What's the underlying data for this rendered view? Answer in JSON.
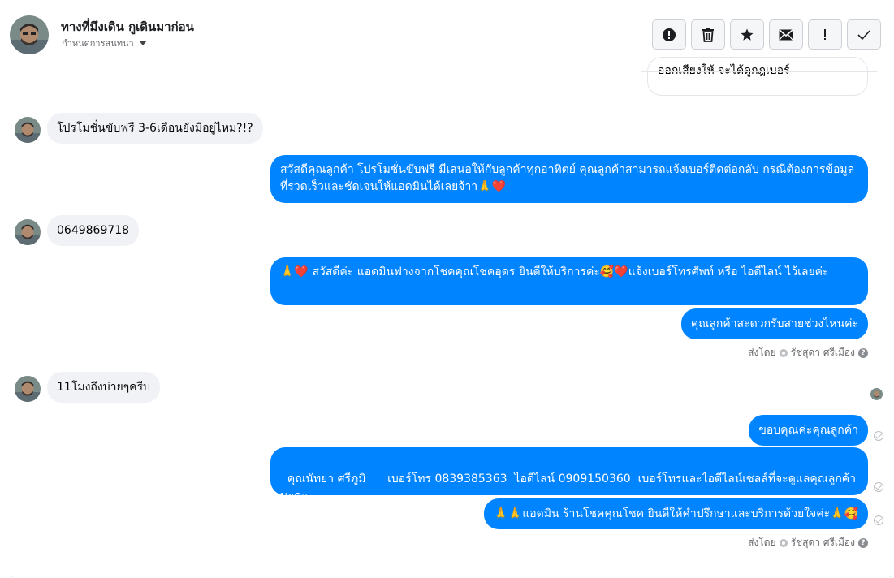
{
  "header": {
    "name": "ทางที่มึงเดิน กูเดินมาก่อน",
    "subtitle": "กำหนดการสนทนา",
    "actions": [
      {
        "name": "report-icon",
        "label": "!"
      },
      {
        "name": "trash-icon",
        "label": "delete"
      },
      {
        "name": "star-icon",
        "label": "star"
      },
      {
        "name": "mail-icon",
        "label": "mail"
      },
      {
        "name": "exclamation-icon",
        "label": "!"
      },
      {
        "name": "check-icon",
        "label": "done"
      }
    ]
  },
  "messages": {
    "top_cut": "ออกเสียงให้ จะได้ดูกฎเบอร์",
    "m1": "โปรโมชั่นขับฟรี 3-6เดือนยังมีอยู่ไหม?!?",
    "m2": "สวัสดีคุณลูกค้า โปรโมชั่นขับฟรี มีเสนอให้กับลูกค้าทุกอาทิตย์ คุณลูกค้าสามารถแจ้งเบอร์ติดต่อกลับ กรณีต้องการข้อมูลที่รวดเร็วและชัดเจนให้แอดมินได้เลยจ้าา🙏❤️",
    "m3": "0649869718",
    "m4": "🙏❤️ สวัสดีค่ะ แอดมินฟางจากโชคคุณโชคอุดร ยินดีให้บริการค่ะ🥰❤️แจ้งเบอร์โทรศัพท์ หรือ ไอดีไลน์  ไว้เลยค่ะ",
    "m5": "คุณลูกค้าสะดวกรับสายช่วงไหนค่ะ",
    "sent_by_1": "ส่งโดย",
    "agent_1": "รัชสุดา ศรีเมือง",
    "m6": "11โมงถึงบ่ายๆครีบ",
    "m7": "ขอบคุณค่ะคุณลูกค้า",
    "m8": "คุณนัทยา ศรีภูมิ      เบอร์โทร 0839385363  ไอดีไลน์ 0909150360  เบอร์โทรและไอดีไลน์เซลล์ที่จะดูแลคุณลูกค้านะคะ",
    "m9": "🙏🙏แอดมิน ร้านโชคคุณโชค ยินดีให้คำปรึกษาและบริการด้วยใจค่ะ🙏🥰",
    "sent_by_2": "ส่งโดย",
    "agent_2": "รัชสุดา ศรีเมือง"
  },
  "colors": {
    "outgoing": "#0084ff",
    "incoming": "#f0f2f5"
  }
}
